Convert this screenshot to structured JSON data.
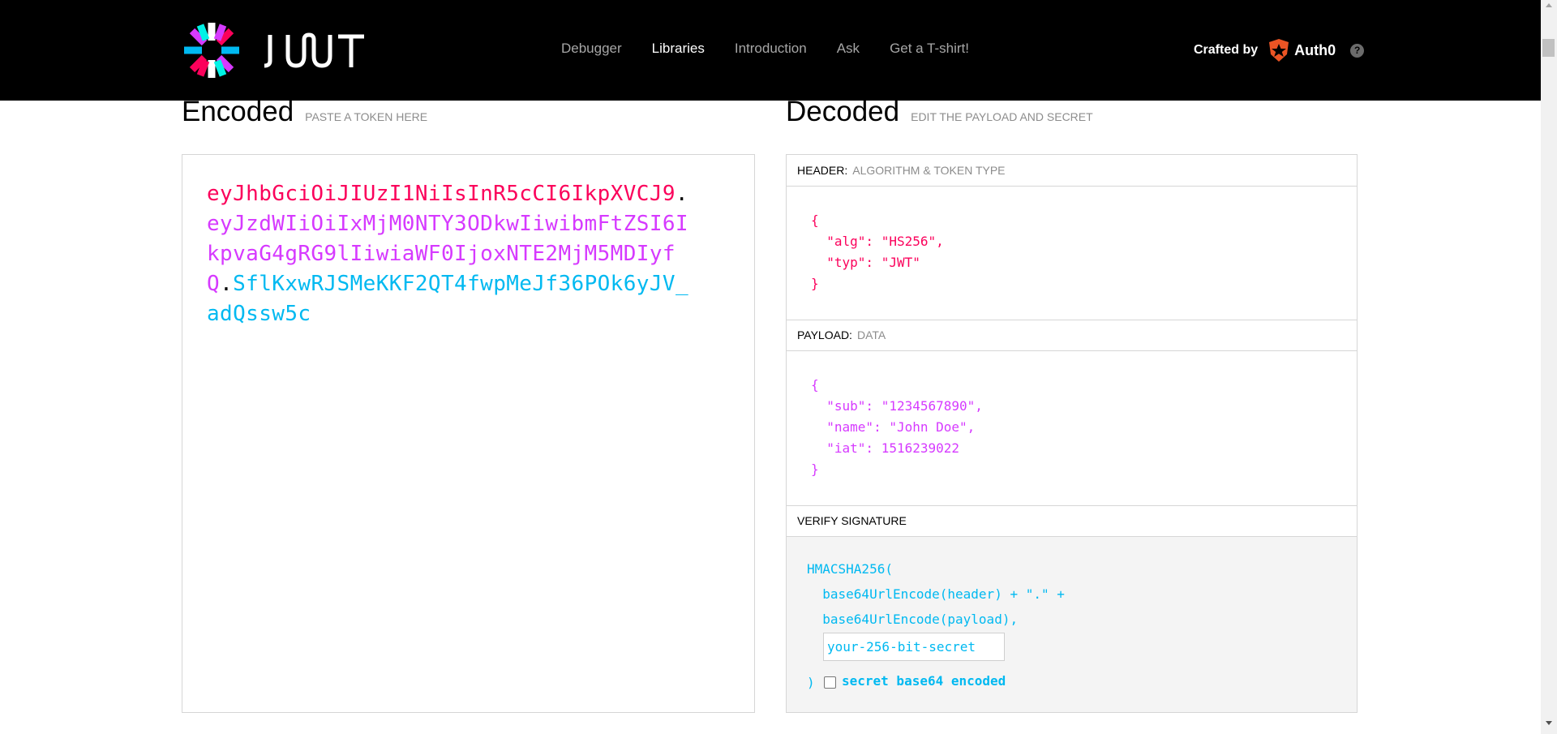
{
  "header": {
    "nav": [
      {
        "label": "Debugger",
        "active": false
      },
      {
        "label": "Libraries",
        "active": true
      },
      {
        "label": "Introduction",
        "active": false
      },
      {
        "label": "Ask",
        "active": false
      },
      {
        "label": "Get a T-shirt!",
        "active": false
      }
    ],
    "crafted_by_label": "Crafted by",
    "auth0_text": "Auth0",
    "help_glyph": "?",
    "logo_icon": "jwt-logo-icon",
    "logo_text": "JWT"
  },
  "encoded": {
    "title": "Encoded",
    "subtitle": "PASTE A TOKEN HERE",
    "token_header": "eyJhbGciOiJIUzI1NiIsInR5cCI6IkpXVCJ9",
    "token_payload": "eyJzdWIiOiIxMjM0NTY3ODkwIiwibmFtZSI6IkpvaG4gRG9lIiwiaWF0IjoxNTE2MjM5MDIyfQ",
    "token_signature": "SflKxwRJSMeKKF2QT4fwpMeJf36POk6yJV_adQssw5c",
    "dot": "."
  },
  "decoded": {
    "title": "Decoded",
    "subtitle": "EDIT THE PAYLOAD AND SECRET",
    "header_panel": {
      "label": "HEADER:",
      "sub": "ALGORITHM & TOKEN TYPE",
      "lines": [
        "{",
        "  \"alg\": \"HS256\",",
        "  \"typ\": \"JWT\"",
        "}"
      ]
    },
    "payload_panel": {
      "label": "PAYLOAD:",
      "sub": "DATA",
      "lines": [
        "{",
        "  \"sub\": \"1234567890\",",
        "  \"name\": \"John Doe\",",
        "  \"iat\": 1516239022",
        "}"
      ]
    },
    "verify_panel": {
      "label": "VERIFY SIGNATURE",
      "line1": "HMACSHA256(",
      "line2": "  base64UrlEncode(header) + \".\" +",
      "line3": "  base64UrlEncode(payload),",
      "secret_placeholder": "your-256-bit-secret",
      "close": ")",
      "checkbox_label": "secret base64 encoded"
    }
  },
  "colors": {
    "header": "#fb015b",
    "payload": "#d63aff",
    "signature": "#00b9f1",
    "auth0": "#eb5424"
  }
}
